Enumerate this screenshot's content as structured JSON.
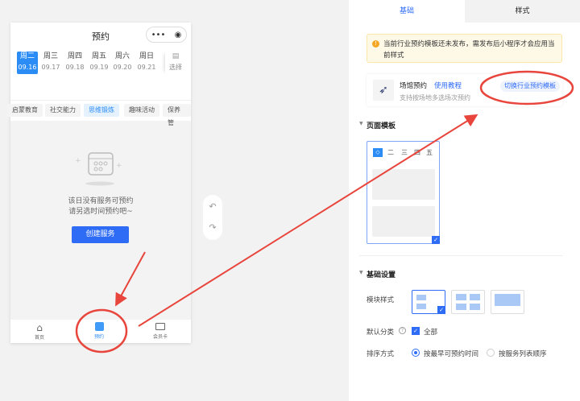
{
  "phone": {
    "title": "预约",
    "dates": [
      {
        "week": "周二",
        "date": "09.16"
      },
      {
        "week": "周三",
        "date": "09.17"
      },
      {
        "week": "周四",
        "date": "09.18"
      },
      {
        "week": "周五",
        "date": "09.19"
      },
      {
        "week": "周六",
        "date": "09.20"
      },
      {
        "week": "周日",
        "date": "09.21"
      }
    ],
    "select_label": "选择",
    "categories": [
      "启蒙教育",
      "社交能力",
      "思维锻炼",
      "趣味活动",
      "保养管"
    ],
    "empty_line1": "该日没有服务可预约",
    "empty_line2": "请另选时间预约吧~",
    "create_button": "创建服务",
    "tabbar": [
      "首页",
      "预约",
      "会员卡"
    ]
  },
  "panel": {
    "tabs": [
      "基础",
      "样式"
    ],
    "notice": "当前行业预约模板还未发布，需发布后小程序才会应用当前样式",
    "template_name": "场馆预约",
    "tutorial_link": "使用教程",
    "template_desc": "支持按场地多选场次预约",
    "switch_button": "切换行业预约模板",
    "section_page_template": "页面模板",
    "preview_tabs": [
      "一",
      "二",
      "三",
      "四",
      "五"
    ],
    "section_basic": "基础设置",
    "module_style_label": "模块样式",
    "default_category_label": "默认分类",
    "default_category_value": "全部",
    "sort_label": "排序方式",
    "sort_options": [
      "按最早可预约时间",
      "按服务列表顺序"
    ]
  },
  "colors": {
    "accent": "#2f6cf6",
    "annotation": "#e8453c"
  }
}
